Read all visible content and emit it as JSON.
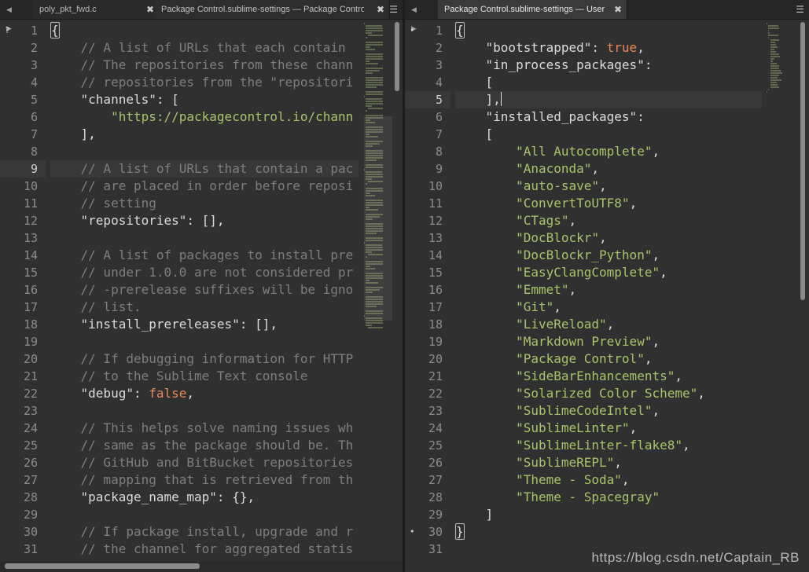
{
  "tabs_left": [
    {
      "label": "poly_pkt_fwd.c",
      "active": false
    },
    {
      "label": "Package Control.sublime-settings — Package Control",
      "active": true
    }
  ],
  "tabs_right": [
    {
      "label": "Package Control.sublime-settings — User",
      "active": true
    }
  ],
  "icons": {
    "nav_left": "triangle-left-icon",
    "nav_right": "triangle-right-icon",
    "close": "close-icon",
    "menu": "hamburger-menu-icon"
  },
  "glyphs": {
    "nav": "◀ ▶",
    "close": "✖",
    "menu": "☰",
    "dot": "•",
    "unknown": "?"
  },
  "left_editor": {
    "start_line": 1,
    "current_line": 9,
    "lines": [
      [
        [
          "p",
          "{"
        ]
      ],
      [
        [
          "x",
          "    "
        ],
        [
          "c",
          "// A list of URLs that each contain"
        ]
      ],
      [
        [
          "x",
          "    "
        ],
        [
          "c",
          "// The repositories from these chann"
        ]
      ],
      [
        [
          "x",
          "    "
        ],
        [
          "c",
          "// repositories from the \"repositori"
        ]
      ],
      [
        [
          "x",
          "    "
        ],
        [
          "k",
          "\"channels\""
        ],
        [
          "p",
          ": ["
        ]
      ],
      [
        [
          "x",
          "        "
        ],
        [
          "s",
          "\"https://packagecontrol.io/chann"
        ]
      ],
      [
        [
          "x",
          "    "
        ],
        [
          "p",
          "],"
        ]
      ],
      [],
      [
        [
          "x",
          "    "
        ],
        [
          "c",
          "// A list of URLs that contain a pac"
        ]
      ],
      [
        [
          "x",
          "    "
        ],
        [
          "c",
          "// are placed in order before reposi"
        ]
      ],
      [
        [
          "x",
          "    "
        ],
        [
          "c",
          "// setting"
        ]
      ],
      [
        [
          "x",
          "    "
        ],
        [
          "k",
          "\"repositories\""
        ],
        [
          "p",
          ": [],"
        ]
      ],
      [],
      [
        [
          "x",
          "    "
        ],
        [
          "c",
          "// A list of packages to install pre"
        ]
      ],
      [
        [
          "x",
          "    "
        ],
        [
          "c",
          "// under 1.0.0 are not considered pr"
        ]
      ],
      [
        [
          "x",
          "    "
        ],
        [
          "c",
          "// -prerelease suffixes will be igno"
        ]
      ],
      [
        [
          "x",
          "    "
        ],
        [
          "c",
          "// list."
        ]
      ],
      [
        [
          "x",
          "    "
        ],
        [
          "k",
          "\"install_prereleases\""
        ],
        [
          "p",
          ": [],"
        ]
      ],
      [],
      [
        [
          "x",
          "    "
        ],
        [
          "c",
          "// If debugging information for HTTP"
        ]
      ],
      [
        [
          "x",
          "    "
        ],
        [
          "c",
          "// to the Sublime Text console"
        ]
      ],
      [
        [
          "x",
          "    "
        ],
        [
          "k",
          "\"debug\""
        ],
        [
          "p",
          ": "
        ],
        [
          "b",
          "false"
        ],
        [
          "p",
          ","
        ]
      ],
      [],
      [
        [
          "x",
          "    "
        ],
        [
          "c",
          "// This helps solve naming issues wh"
        ]
      ],
      [
        [
          "x",
          "    "
        ],
        [
          "c",
          "// same as the package should be. Th"
        ]
      ],
      [
        [
          "x",
          "    "
        ],
        [
          "c",
          "// GitHub and BitBucket repositories"
        ]
      ],
      [
        [
          "x",
          "    "
        ],
        [
          "c",
          "// mapping that is retrieved from th"
        ]
      ],
      [
        [
          "x",
          "    "
        ],
        [
          "k",
          "\"package_name_map\""
        ],
        [
          "p",
          ": {},"
        ]
      ],
      [],
      [
        [
          "x",
          "    "
        ],
        [
          "c",
          "// If package install, upgrade and r"
        ]
      ],
      [
        [
          "x",
          "    "
        ],
        [
          "c",
          "// the channel for aggregated statis"
        ]
      ]
    ]
  },
  "right_editor": {
    "start_line": 1,
    "current_line": 5,
    "lines": [
      [
        [
          "p",
          "{"
        ]
      ],
      [
        [
          "x",
          "    "
        ],
        [
          "k",
          "\"bootstrapped\""
        ],
        [
          "p",
          ": "
        ],
        [
          "b",
          "true"
        ],
        [
          "p",
          ","
        ]
      ],
      [
        [
          "x",
          "    "
        ],
        [
          "k",
          "\"in_process_packages\""
        ],
        [
          "p",
          ":"
        ]
      ],
      [
        [
          "x",
          "    "
        ],
        [
          "p",
          "["
        ]
      ],
      [
        [
          "x",
          "    "
        ],
        [
          "p",
          "],"
        ]
      ],
      [
        [
          "x",
          "    "
        ],
        [
          "k",
          "\"installed_packages\""
        ],
        [
          "p",
          ":"
        ]
      ],
      [
        [
          "x",
          "    "
        ],
        [
          "p",
          "["
        ]
      ],
      [
        [
          "x",
          "        "
        ],
        [
          "s",
          "\"All Autocomplete\""
        ],
        [
          "p",
          ","
        ]
      ],
      [
        [
          "x",
          "        "
        ],
        [
          "s",
          "\"Anaconda\""
        ],
        [
          "p",
          ","
        ]
      ],
      [
        [
          "x",
          "        "
        ],
        [
          "s",
          "\"auto-save\""
        ],
        [
          "p",
          ","
        ]
      ],
      [
        [
          "x",
          "        "
        ],
        [
          "s",
          "\"ConvertToUTF8\""
        ],
        [
          "p",
          ","
        ]
      ],
      [
        [
          "x",
          "        "
        ],
        [
          "s",
          "\"CTags\""
        ],
        [
          "p",
          ","
        ]
      ],
      [
        [
          "x",
          "        "
        ],
        [
          "s",
          "\"DocBlockr\""
        ],
        [
          "p",
          ","
        ]
      ],
      [
        [
          "x",
          "        "
        ],
        [
          "s",
          "\"DocBlockr_Python\""
        ],
        [
          "p",
          ","
        ]
      ],
      [
        [
          "x",
          "        "
        ],
        [
          "s",
          "\"EasyClangComplete\""
        ],
        [
          "p",
          ","
        ]
      ],
      [
        [
          "x",
          "        "
        ],
        [
          "s",
          "\"Emmet\""
        ],
        [
          "p",
          ","
        ]
      ],
      [
        [
          "x",
          "        "
        ],
        [
          "s",
          "\"Git\""
        ],
        [
          "p",
          ","
        ]
      ],
      [
        [
          "x",
          "        "
        ],
        [
          "s",
          "\"LiveReload\""
        ],
        [
          "p",
          ","
        ]
      ],
      [
        [
          "x",
          "        "
        ],
        [
          "s",
          "\"Markdown Preview\""
        ],
        [
          "p",
          ","
        ]
      ],
      [
        [
          "x",
          "        "
        ],
        [
          "s",
          "\"Package Control\""
        ],
        [
          "p",
          ","
        ]
      ],
      [
        [
          "x",
          "        "
        ],
        [
          "s",
          "\"SideBarEnhancements\""
        ],
        [
          "p",
          ","
        ]
      ],
      [
        [
          "x",
          "        "
        ],
        [
          "s",
          "\"Solarized Color Scheme\""
        ],
        [
          "p",
          ","
        ]
      ],
      [
        [
          "x",
          "        "
        ],
        [
          "s",
          "\"SublimeCodeIntel\""
        ],
        [
          "p",
          ","
        ]
      ],
      [
        [
          "x",
          "        "
        ],
        [
          "s",
          "\"SublimeLinter\""
        ],
        [
          "p",
          ","
        ]
      ],
      [
        [
          "x",
          "        "
        ],
        [
          "s",
          "\"SublimeLinter-flake8\""
        ],
        [
          "p",
          ","
        ]
      ],
      [
        [
          "x",
          "        "
        ],
        [
          "s",
          "\"SublimeREPL\""
        ],
        [
          "p",
          ","
        ]
      ],
      [
        [
          "x",
          "        "
        ],
        [
          "s",
          "\"Theme - Soda\""
        ],
        [
          "p",
          ","
        ]
      ],
      [
        [
          "x",
          "        "
        ],
        [
          "s",
          "\"Theme - Spacegray\""
        ]
      ],
      [
        [
          "x",
          "    "
        ],
        [
          "p",
          "]"
        ]
      ],
      [
        [
          "p",
          "}"
        ]
      ],
      []
    ]
  },
  "watermark": "https://blog.csdn.net/Captain_RB",
  "colors": {
    "comment": "#7e7e7e",
    "string": "#a9c46b",
    "boolean": "#e8895a",
    "text": "#dcdcdc",
    "background": "#303030"
  }
}
